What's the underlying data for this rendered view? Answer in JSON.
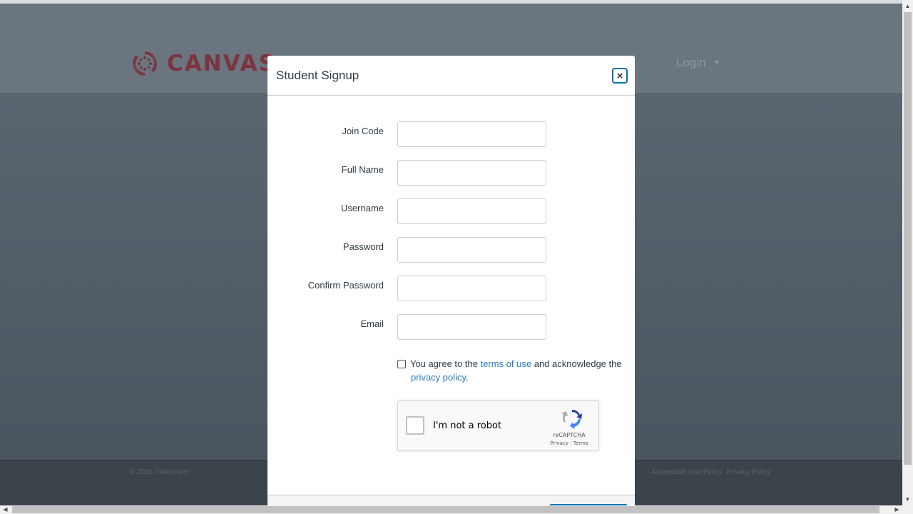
{
  "background": {
    "brand": "CANVAS",
    "login_label": "Login",
    "login_caret": "▼",
    "footer_copyright": "© 2021",
    "footer_company": "Instructure",
    "footer_links": [
      "Acceptable Use Policy",
      "Privacy Policy"
    ]
  },
  "modal": {
    "title": "Student Signup",
    "close_symbol": "×",
    "fields": [
      {
        "label": "Join Code",
        "value": ""
      },
      {
        "label": "Full Name",
        "value": ""
      },
      {
        "label": "Username",
        "value": ""
      },
      {
        "label": "Password",
        "value": ""
      },
      {
        "label": "Confirm Password",
        "value": ""
      },
      {
        "label": "Email",
        "value": ""
      }
    ],
    "agree": {
      "prefix": "You agree to the",
      "terms_link": "terms of use",
      "middle": "and acknowledge the",
      "privacy_link": "privacy policy",
      "suffix": "."
    },
    "recaptcha": {
      "label": "I'm not a robot",
      "brand": "reCAPTCHA",
      "terms": "Privacy - Terms"
    }
  },
  "colors": {
    "brand_red": "#7e2e37",
    "link_blue": "#2b7abc",
    "focus_blue": "#0770a3"
  }
}
